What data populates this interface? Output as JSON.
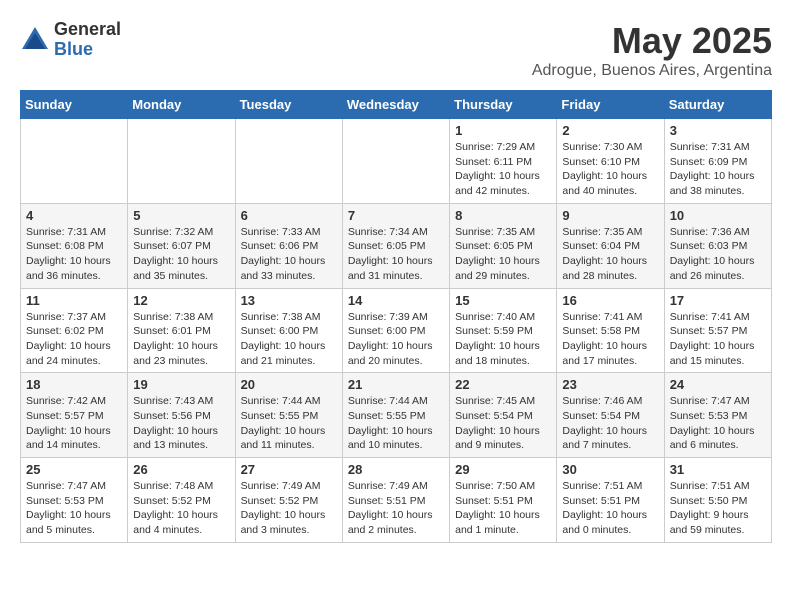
{
  "logo": {
    "general": "General",
    "blue": "Blue"
  },
  "header": {
    "month": "May 2025",
    "location": "Adrogue, Buenos Aires, Argentina"
  },
  "weekdays": [
    "Sunday",
    "Monday",
    "Tuesday",
    "Wednesday",
    "Thursday",
    "Friday",
    "Saturday"
  ],
  "weeks": [
    [
      {
        "day": "",
        "content": ""
      },
      {
        "day": "",
        "content": ""
      },
      {
        "day": "",
        "content": ""
      },
      {
        "day": "",
        "content": ""
      },
      {
        "day": "1",
        "content": "Sunrise: 7:29 AM\nSunset: 6:11 PM\nDaylight: 10 hours\nand 42 minutes."
      },
      {
        "day": "2",
        "content": "Sunrise: 7:30 AM\nSunset: 6:10 PM\nDaylight: 10 hours\nand 40 minutes."
      },
      {
        "day": "3",
        "content": "Sunrise: 7:31 AM\nSunset: 6:09 PM\nDaylight: 10 hours\nand 38 minutes."
      }
    ],
    [
      {
        "day": "4",
        "content": "Sunrise: 7:31 AM\nSunset: 6:08 PM\nDaylight: 10 hours\nand 36 minutes."
      },
      {
        "day": "5",
        "content": "Sunrise: 7:32 AM\nSunset: 6:07 PM\nDaylight: 10 hours\nand 35 minutes."
      },
      {
        "day": "6",
        "content": "Sunrise: 7:33 AM\nSunset: 6:06 PM\nDaylight: 10 hours\nand 33 minutes."
      },
      {
        "day": "7",
        "content": "Sunrise: 7:34 AM\nSunset: 6:05 PM\nDaylight: 10 hours\nand 31 minutes."
      },
      {
        "day": "8",
        "content": "Sunrise: 7:35 AM\nSunset: 6:05 PM\nDaylight: 10 hours\nand 29 minutes."
      },
      {
        "day": "9",
        "content": "Sunrise: 7:35 AM\nSunset: 6:04 PM\nDaylight: 10 hours\nand 28 minutes."
      },
      {
        "day": "10",
        "content": "Sunrise: 7:36 AM\nSunset: 6:03 PM\nDaylight: 10 hours\nand 26 minutes."
      }
    ],
    [
      {
        "day": "11",
        "content": "Sunrise: 7:37 AM\nSunset: 6:02 PM\nDaylight: 10 hours\nand 24 minutes."
      },
      {
        "day": "12",
        "content": "Sunrise: 7:38 AM\nSunset: 6:01 PM\nDaylight: 10 hours\nand 23 minutes."
      },
      {
        "day": "13",
        "content": "Sunrise: 7:38 AM\nSunset: 6:00 PM\nDaylight: 10 hours\nand 21 minutes."
      },
      {
        "day": "14",
        "content": "Sunrise: 7:39 AM\nSunset: 6:00 PM\nDaylight: 10 hours\nand 20 minutes."
      },
      {
        "day": "15",
        "content": "Sunrise: 7:40 AM\nSunset: 5:59 PM\nDaylight: 10 hours\nand 18 minutes."
      },
      {
        "day": "16",
        "content": "Sunrise: 7:41 AM\nSunset: 5:58 PM\nDaylight: 10 hours\nand 17 minutes."
      },
      {
        "day": "17",
        "content": "Sunrise: 7:41 AM\nSunset: 5:57 PM\nDaylight: 10 hours\nand 15 minutes."
      }
    ],
    [
      {
        "day": "18",
        "content": "Sunrise: 7:42 AM\nSunset: 5:57 PM\nDaylight: 10 hours\nand 14 minutes."
      },
      {
        "day": "19",
        "content": "Sunrise: 7:43 AM\nSunset: 5:56 PM\nDaylight: 10 hours\nand 13 minutes."
      },
      {
        "day": "20",
        "content": "Sunrise: 7:44 AM\nSunset: 5:55 PM\nDaylight: 10 hours\nand 11 minutes."
      },
      {
        "day": "21",
        "content": "Sunrise: 7:44 AM\nSunset: 5:55 PM\nDaylight: 10 hours\nand 10 minutes."
      },
      {
        "day": "22",
        "content": "Sunrise: 7:45 AM\nSunset: 5:54 PM\nDaylight: 10 hours\nand 9 minutes."
      },
      {
        "day": "23",
        "content": "Sunrise: 7:46 AM\nSunset: 5:54 PM\nDaylight: 10 hours\nand 7 minutes."
      },
      {
        "day": "24",
        "content": "Sunrise: 7:47 AM\nSunset: 5:53 PM\nDaylight: 10 hours\nand 6 minutes."
      }
    ],
    [
      {
        "day": "25",
        "content": "Sunrise: 7:47 AM\nSunset: 5:53 PM\nDaylight: 10 hours\nand 5 minutes."
      },
      {
        "day": "26",
        "content": "Sunrise: 7:48 AM\nSunset: 5:52 PM\nDaylight: 10 hours\nand 4 minutes."
      },
      {
        "day": "27",
        "content": "Sunrise: 7:49 AM\nSunset: 5:52 PM\nDaylight: 10 hours\nand 3 minutes."
      },
      {
        "day": "28",
        "content": "Sunrise: 7:49 AM\nSunset: 5:51 PM\nDaylight: 10 hours\nand 2 minutes."
      },
      {
        "day": "29",
        "content": "Sunrise: 7:50 AM\nSunset: 5:51 PM\nDaylight: 10 hours\nand 1 minute."
      },
      {
        "day": "30",
        "content": "Sunrise: 7:51 AM\nSunset: 5:51 PM\nDaylight: 10 hours\nand 0 minutes."
      },
      {
        "day": "31",
        "content": "Sunrise: 7:51 AM\nSunset: 5:50 PM\nDaylight: 9 hours\nand 59 minutes."
      }
    ]
  ]
}
